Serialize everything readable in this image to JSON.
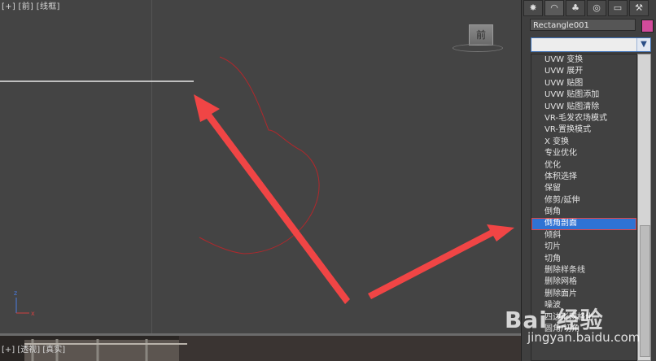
{
  "viewport_top": {
    "label": "[+] [前] [线框]",
    "viewcube_label": "前"
  },
  "viewport_bottom": {
    "label": "[+] [透视] [真实]"
  },
  "toolbar": {
    "icons": [
      "sun-icon",
      "arc-icon",
      "hierarchy-icon",
      "motion-icon",
      "display-icon",
      "hammer-icon"
    ]
  },
  "object": {
    "name": "Rectangle001",
    "color": "#d24b9b"
  },
  "modifier_dropdown": {
    "value": ""
  },
  "modifier_list": {
    "items": [
      "UVW 变换",
      "UVW 展开",
      "UVW 贴图",
      "UVW 贴图添加",
      "UVW 贴图清除",
      "VR-毛发农场模式",
      "VR-置换模式",
      "X 变换",
      "专业优化",
      "优化",
      "体积选择",
      "保留",
      "修剪/延伸",
      "倒角",
      "倒角剖面",
      "倾斜",
      "切片",
      "切角",
      "删除样条线",
      "删除网格",
      "删除面片",
      "噪波",
      "四边形网格化",
      "圆角/切角"
    ],
    "selected": "倒角剖面"
  },
  "watermark": {
    "text": "Bai 经验",
    "sub": "jingyan.baidu.com"
  },
  "colors": {
    "arrow": "#f04545",
    "curve": "#b0282c",
    "selection": "#2f73d4"
  }
}
